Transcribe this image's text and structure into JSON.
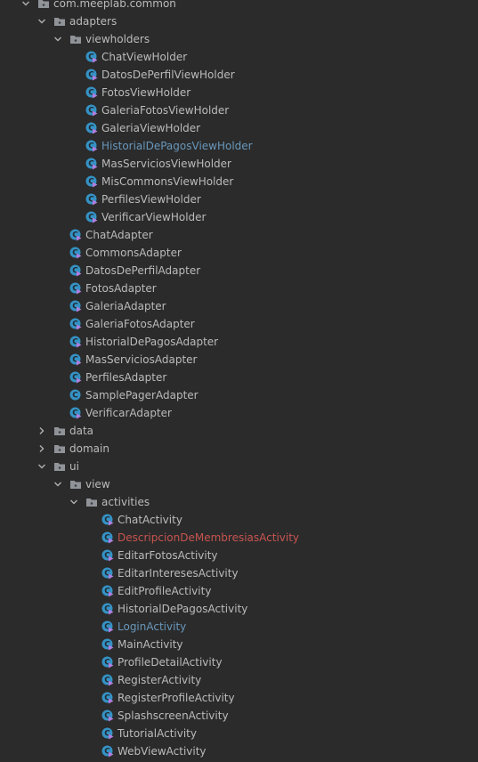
{
  "project_tree": {
    "status_colors": {
      "normal": "#bbbbbb",
      "modified": "#6897bb",
      "changed": "#c75450"
    },
    "nodes": [
      {
        "label": "com.meeplab.common",
        "kind": "package",
        "level": 1,
        "expanded": true
      },
      {
        "label": "adapters",
        "kind": "package",
        "level": 2,
        "expanded": true
      },
      {
        "label": "viewholders",
        "kind": "package",
        "level": 3,
        "expanded": true
      },
      {
        "label": "ChatViewHolder",
        "kind": "class-lock",
        "level": 4
      },
      {
        "label": "DatosDePerfilViewHolder",
        "kind": "class-lock",
        "level": 4
      },
      {
        "label": "FotosViewHolder",
        "kind": "class-lock",
        "level": 4
      },
      {
        "label": "GaleriaFotosViewHolder",
        "kind": "class-lock",
        "level": 4
      },
      {
        "label": "GaleriaViewHolder",
        "kind": "class-lock",
        "level": 4
      },
      {
        "label": "HistorialDePagosViewHolder",
        "kind": "class-lock",
        "level": 4,
        "status": "modified"
      },
      {
        "label": "MasServiciosViewHolder",
        "kind": "class-lock",
        "level": 4
      },
      {
        "label": "MisCommonsViewHolder",
        "kind": "class-lock",
        "level": 4
      },
      {
        "label": "PerfilesViewHolder",
        "kind": "class-lock",
        "level": 4
      },
      {
        "label": "VerificarViewHolder",
        "kind": "class-lock",
        "level": 4
      },
      {
        "label": "ChatAdapter",
        "kind": "class-lock",
        "level": 3
      },
      {
        "label": "CommonsAdapter",
        "kind": "class-lock",
        "level": 3
      },
      {
        "label": "DatosDePerfilAdapter",
        "kind": "class-lock",
        "level": 3
      },
      {
        "label": "FotosAdapter",
        "kind": "class-lock",
        "level": 3
      },
      {
        "label": "GaleriaAdapter",
        "kind": "class-lock",
        "level": 3
      },
      {
        "label": "GaleriaFotosAdapter",
        "kind": "class-lock",
        "level": 3
      },
      {
        "label": "HistorialDePagosAdapter",
        "kind": "class-lock",
        "level": 3
      },
      {
        "label": "MasServiciosAdapter",
        "kind": "class-lock",
        "level": 3
      },
      {
        "label": "PerfilesAdapter",
        "kind": "class-lock",
        "level": 3
      },
      {
        "label": "SamplePagerAdapter",
        "kind": "class",
        "level": 3
      },
      {
        "label": "VerificarAdapter",
        "kind": "class-lock",
        "level": 3
      },
      {
        "label": "data",
        "kind": "package",
        "level": 2,
        "expanded": false
      },
      {
        "label": "domain",
        "kind": "package",
        "level": 2,
        "expanded": false
      },
      {
        "label": "ui",
        "kind": "package",
        "level": 2,
        "expanded": true
      },
      {
        "label": "view",
        "kind": "package",
        "level": 3,
        "expanded": true
      },
      {
        "label": "activities",
        "kind": "package",
        "level": 4,
        "expanded": true
      },
      {
        "label": "ChatActivity",
        "kind": "class-lock",
        "level": 5
      },
      {
        "label": "DescripcionDeMembresiasActivity",
        "kind": "class-lock",
        "level": 5,
        "status": "changed"
      },
      {
        "label": "EditarFotosActivity",
        "kind": "class-lock",
        "level": 5
      },
      {
        "label": "EditarInteresesActivity",
        "kind": "class-lock",
        "level": 5
      },
      {
        "label": "EditProfileActivity",
        "kind": "class-lock",
        "level": 5
      },
      {
        "label": "HistorialDePagosActivity",
        "kind": "class-lock",
        "level": 5
      },
      {
        "label": "LoginActivity",
        "kind": "class-lock",
        "level": 5,
        "status": "modified"
      },
      {
        "label": "MainActivity",
        "kind": "class-lock",
        "level": 5
      },
      {
        "label": "ProfileDetailActivity",
        "kind": "class-lock",
        "level": 5
      },
      {
        "label": "RegisterActivity",
        "kind": "class-lock",
        "level": 5
      },
      {
        "label": "RegisterProfileActivity",
        "kind": "class-lock",
        "level": 5
      },
      {
        "label": "SplashscreenActivity",
        "kind": "class-lock",
        "level": 5
      },
      {
        "label": "TutorialActivity",
        "kind": "class-lock",
        "level": 5
      },
      {
        "label": "WebViewActivity",
        "kind": "class-lock",
        "level": 5
      }
    ]
  }
}
